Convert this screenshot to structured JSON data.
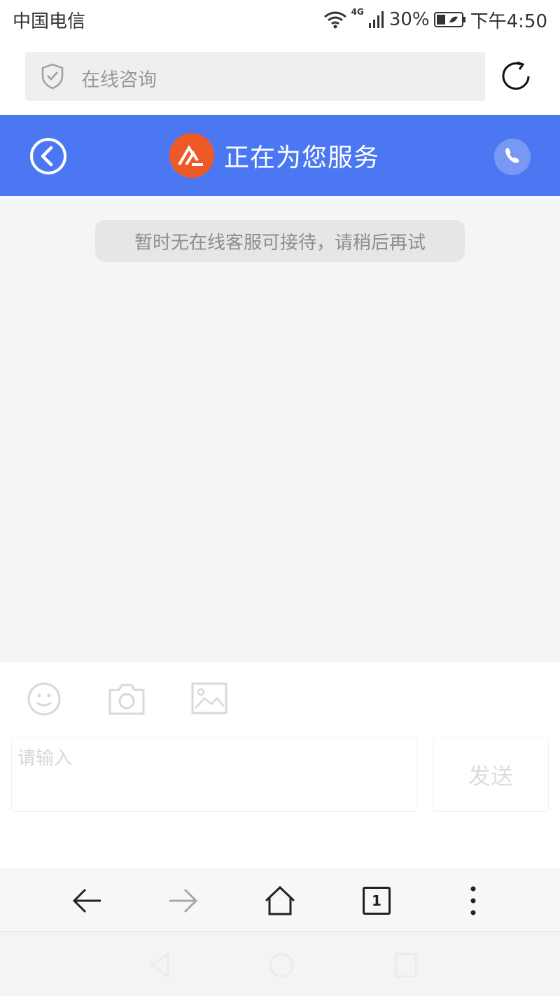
{
  "status_bar": {
    "carrier": "中国电信",
    "network": "4G",
    "battery": "30%",
    "time": "下午4:50"
  },
  "address_bar": {
    "placeholder": "在线咨询"
  },
  "chat_header": {
    "title": "正在为您服务"
  },
  "chat": {
    "notice": "暂时无在线客服可接待，请稍后再试"
  },
  "input": {
    "placeholder": "请输入",
    "send_label": "发送"
  },
  "toolbar": {
    "tab_count": "1"
  },
  "icons": {
    "shield": "shield-icon",
    "refresh": "refresh-icon",
    "back": "back-circle-icon",
    "phone": "phone-icon",
    "emoji": "emoji-icon",
    "camera": "camera-icon",
    "image": "image-icon",
    "back_arrow": "arrow-left-icon",
    "forward_arrow": "arrow-right-icon",
    "home": "home-icon",
    "more": "more-vertical-icon"
  },
  "colors": {
    "header_bg": "#4b78f2",
    "brand_logo": "#ee5a27",
    "chat_bg": "#f5f5f6"
  }
}
